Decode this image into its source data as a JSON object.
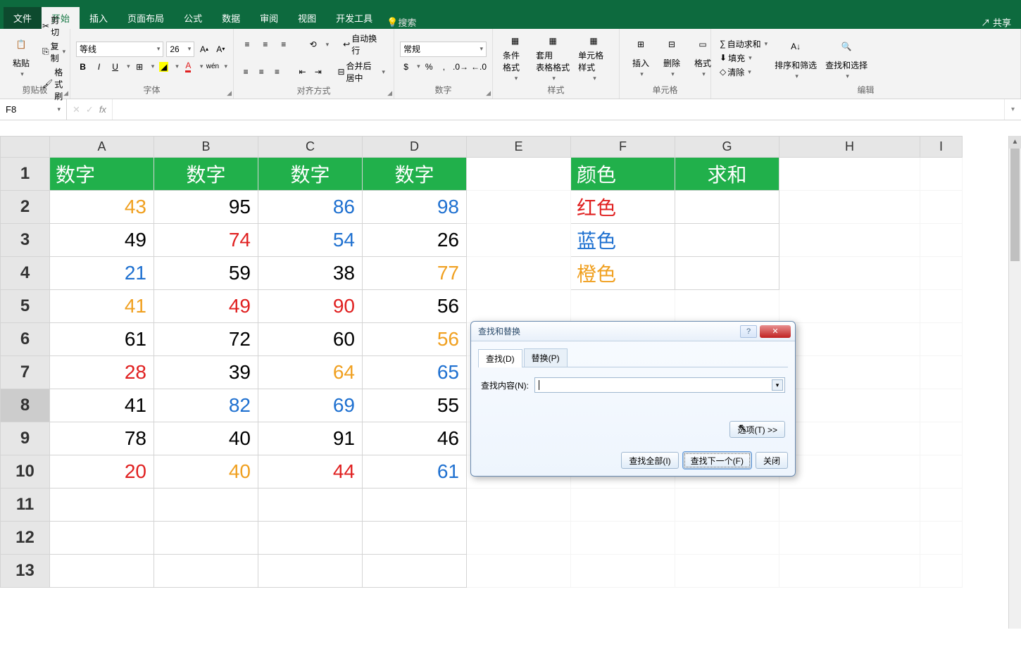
{
  "tabs": {
    "file": "文件",
    "home": "开始",
    "insert": "插入",
    "layout": "页面布局",
    "formulas": "公式",
    "data": "数据",
    "review": "审阅",
    "view": "视图",
    "dev": "开发工具",
    "search": "搜索",
    "share": "共享"
  },
  "ribbon": {
    "clipboard": {
      "paste": "粘贴",
      "cut": "剪切",
      "copy": "复制",
      "format_painter": "格式刷",
      "label": "剪贴板"
    },
    "font": {
      "name": "等线",
      "size": "26",
      "bold": "B",
      "italic": "I",
      "underline": "U",
      "label": "字体"
    },
    "align": {
      "wrap": "自动换行",
      "merge": "合并后居中",
      "label": "对齐方式"
    },
    "number": {
      "format": "常规",
      "percent": "%",
      "comma": ",",
      "label": "数字"
    },
    "styles": {
      "cond": "条件格式",
      "table": "套用\n表格格式",
      "cell": "单元格样式",
      "label": "样式"
    },
    "cells": {
      "insert": "插入",
      "delete": "删除",
      "format": "格式",
      "label": "单元格"
    },
    "editing": {
      "sum": "自动求和",
      "fill": "填充",
      "clear": "清除",
      "sort": "排序和筛选",
      "find": "查找和选择",
      "label": "编辑"
    }
  },
  "namebox": "F8",
  "columns": [
    "A",
    "B",
    "C",
    "D",
    "E",
    "F",
    "G",
    "H",
    "I"
  ],
  "headers": {
    "A": "数字",
    "B": "数字",
    "C": "数字",
    "D": "数字",
    "F": "颜色",
    "G": "求和"
  },
  "rows": [
    {
      "A": {
        "v": "43",
        "c": "orange"
      },
      "B": {
        "v": "95",
        "c": "black"
      },
      "C": {
        "v": "86",
        "c": "blue"
      },
      "D": {
        "v": "98",
        "c": "blue"
      }
    },
    {
      "A": {
        "v": "49",
        "c": "black"
      },
      "B": {
        "v": "74",
        "c": "red"
      },
      "C": {
        "v": "54",
        "c": "blue"
      },
      "D": {
        "v": "26",
        "c": "black"
      }
    },
    {
      "A": {
        "v": "21",
        "c": "blue"
      },
      "B": {
        "v": "59",
        "c": "black"
      },
      "C": {
        "v": "38",
        "c": "black"
      },
      "D": {
        "v": "77",
        "c": "orange"
      }
    },
    {
      "A": {
        "v": "41",
        "c": "orange"
      },
      "B": {
        "v": "49",
        "c": "red"
      },
      "C": {
        "v": "90",
        "c": "red"
      },
      "D": {
        "v": "56",
        "c": "black"
      }
    },
    {
      "A": {
        "v": "61",
        "c": "black"
      },
      "B": {
        "v": "72",
        "c": "black"
      },
      "C": {
        "v": "60",
        "c": "black"
      },
      "D": {
        "v": "56",
        "c": "orange"
      }
    },
    {
      "A": {
        "v": "28",
        "c": "red"
      },
      "B": {
        "v": "39",
        "c": "black"
      },
      "C": {
        "v": "64",
        "c": "orange"
      },
      "D": {
        "v": "65",
        "c": "blue"
      }
    },
    {
      "A": {
        "v": "41",
        "c": "black"
      },
      "B": {
        "v": "82",
        "c": "blue"
      },
      "C": {
        "v": "69",
        "c": "blue"
      },
      "D": {
        "v": "55",
        "c": "black"
      }
    },
    {
      "A": {
        "v": "78",
        "c": "black"
      },
      "B": {
        "v": "40",
        "c": "black"
      },
      "C": {
        "v": "91",
        "c": "black"
      },
      "D": {
        "v": "46",
        "c": "black"
      }
    },
    {
      "A": {
        "v": "20",
        "c": "red"
      },
      "B": {
        "v": "40",
        "c": "orange"
      },
      "C": {
        "v": "44",
        "c": "red"
      },
      "D": {
        "v": "61",
        "c": "blue"
      }
    }
  ],
  "side": [
    {
      "label": "红色",
      "c": "red"
    },
    {
      "label": "蓝色",
      "c": "blue"
    },
    {
      "label": "橙色",
      "c": "orange"
    }
  ],
  "dialog": {
    "title": "查找和替换",
    "tab_find": "查找(D)",
    "tab_replace": "替换(P)",
    "find_label": "查找内容(N):",
    "options": "选项(T) >>",
    "find_all": "查找全部(I)",
    "find_next": "查找下一个(F)",
    "close": "关闭"
  }
}
